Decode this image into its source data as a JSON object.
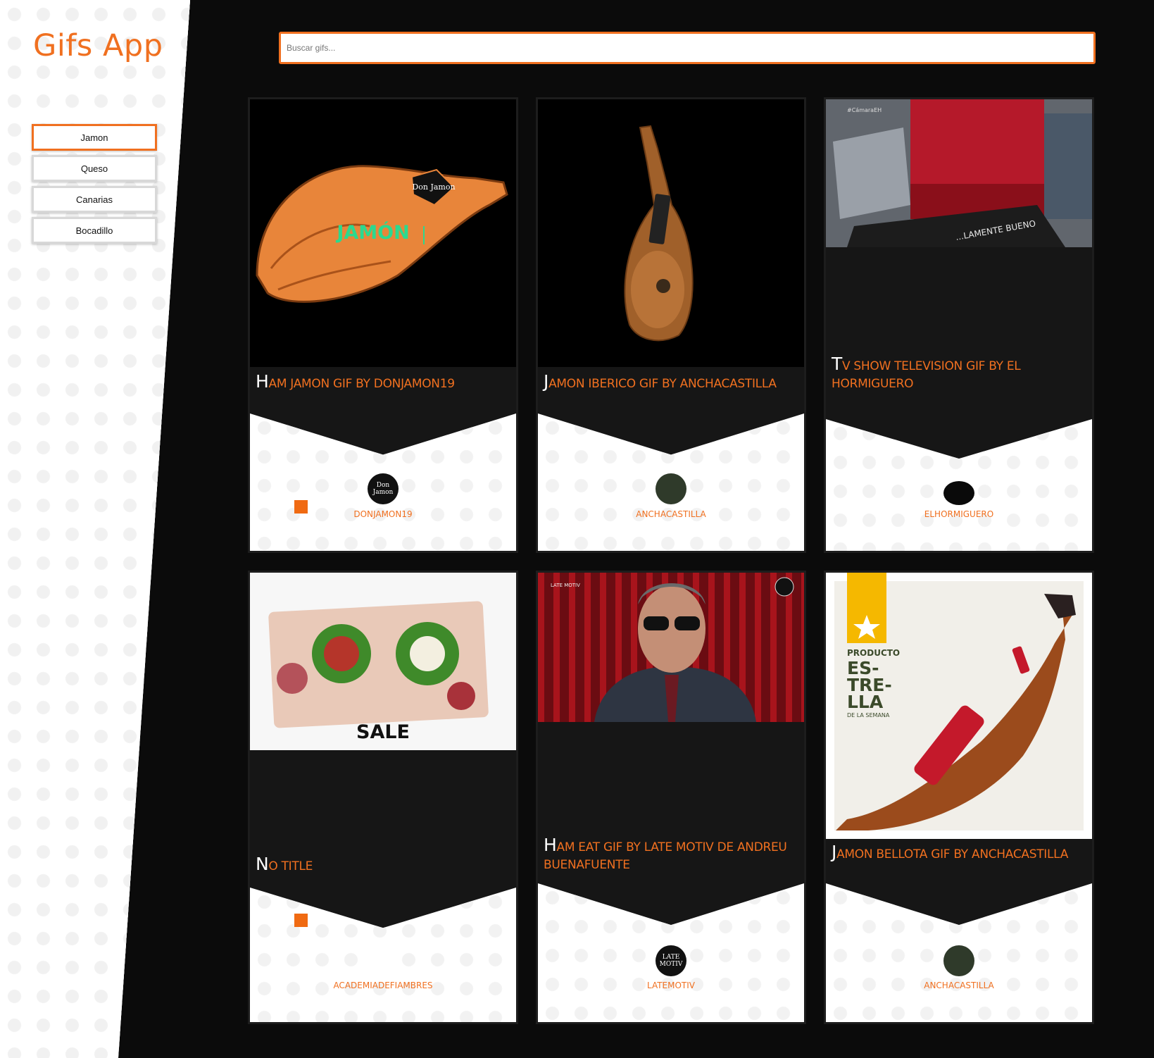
{
  "sidebar": {
    "title": "Gifs App",
    "categories": [
      {
        "label": "Jamon",
        "active": true
      },
      {
        "label": "Queso",
        "active": false
      },
      {
        "label": "Canarias",
        "active": false
      },
      {
        "label": "Bocadillo",
        "active": false
      }
    ]
  },
  "search": {
    "placeholder": "Buscar gifs...",
    "value": ""
  },
  "theme": {
    "accent": "#f07020",
    "background": "#0b0b0b",
    "card": "#161616"
  },
  "gifs": [
    {
      "title": "Ham Jamon GIF by DonJamon19",
      "username": "DONJAMON19",
      "image_text": "JAMÓN",
      "badge_text": "Don Jamon",
      "avatar_text": "Don Jamon"
    },
    {
      "title": "Jamon Iberico GIF by anchacastilla",
      "username": "ANCHACASTILLA",
      "avatar_text": ""
    },
    {
      "title": "Tv Show Television GIF by El Hormiguero",
      "username": "ELHORMIGUERO",
      "image_text": "#CámaraEH",
      "sign_text": "...LAMENTE BUENO",
      "avatar_text": ""
    },
    {
      "title": "No title",
      "username": "ACADEMIADEFIAMBRES",
      "image_text": "SALE",
      "avatar_text": ""
    },
    {
      "title": "Ham Eat GIF by Late Motiv de Andreu Buenafuente",
      "username": "LATEMOTIV",
      "image_text": "LATE MOTIV",
      "avatar_text": "LATE MOTIV"
    },
    {
      "title": "Jamon Bellota GIF by anchacastilla",
      "username": "ANCHACASTILLA",
      "image_text": [
        "PRODUCTO",
        "ES-",
        "TRE-",
        "LLA",
        "DE LA SEMANA"
      ],
      "avatar_text": ""
    }
  ]
}
